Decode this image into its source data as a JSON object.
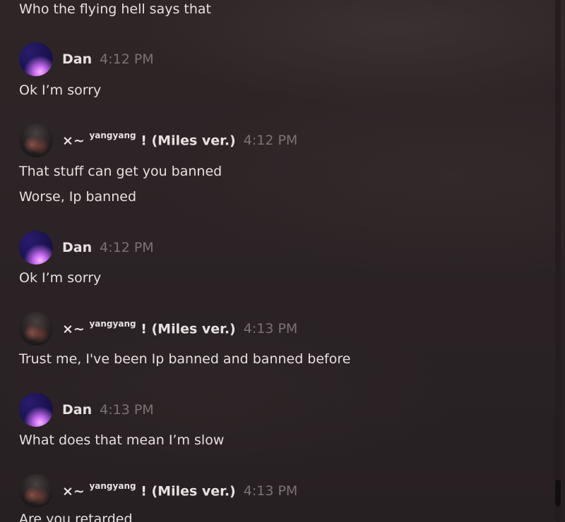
{
  "messages": [
    {
      "kind": "text",
      "text": "Who the flying hell says that"
    },
    {
      "kind": "header",
      "author": "Dan",
      "time": "4:12 PM",
      "avatar": "galaxy-avatar"
    },
    {
      "kind": "text",
      "text": "Ok I’m sorry"
    },
    {
      "kind": "header",
      "author_prefix": "×~",
      "author_sup": "yangyang",
      "author_suffix": "! (Miles ver.)",
      "time": "4:12 PM",
      "avatar": "guitar-photo-avatar"
    },
    {
      "kind": "text",
      "text": "That stuff can get you banned"
    },
    {
      "kind": "text",
      "text": "Worse, Ip banned"
    },
    {
      "kind": "header",
      "author": "Dan",
      "time": "4:12 PM",
      "avatar": "galaxy-avatar"
    },
    {
      "kind": "text",
      "text": "Ok I’m sorry"
    },
    {
      "kind": "header",
      "author_prefix": "×~",
      "author_sup": "yangyang",
      "author_suffix": "! (Miles ver.)",
      "time": "4:13 PM",
      "avatar": "guitar-photo-avatar"
    },
    {
      "kind": "text",
      "text": "Trust me, I've been Ip banned and banned before"
    },
    {
      "kind": "header",
      "author": "Dan",
      "time": "4:13 PM",
      "avatar": "galaxy-avatar"
    },
    {
      "kind": "text",
      "text": "What does that mean I’m slow"
    },
    {
      "kind": "header",
      "author_prefix": "×~",
      "author_sup": "yangyang",
      "author_suffix": "! (Miles ver.)",
      "time": "4:13 PM",
      "avatar": "guitar-photo-avatar"
    },
    {
      "kind": "text",
      "text": "Are you retarded"
    }
  ],
  "colors": {
    "background": "#2a2224",
    "message_text": "#e8dfdf",
    "timestamp": "#7d7273"
  }
}
